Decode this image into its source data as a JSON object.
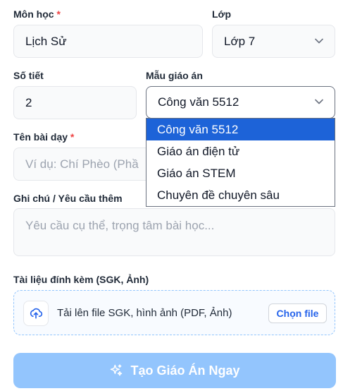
{
  "form": {
    "subject": {
      "label": "Môn học",
      "required_mark": "*",
      "value": "Lịch Sử"
    },
    "grade": {
      "label": "Lớp",
      "value": "Lớp 7"
    },
    "periods": {
      "label": "Số tiết",
      "value": "2"
    },
    "template": {
      "label": "Mẫu giáo án",
      "value": "Công văn 5512",
      "options": [
        "Công văn 5512",
        "Giáo án điện tử",
        "Giáo án STEM",
        "Chuyên đề chuyên sâu"
      ],
      "selected_index": 0
    },
    "lesson_name": {
      "label": "Tên bài dạy",
      "required_mark": "*",
      "placeholder": "Ví dụ: Chí Phèo (Phầ"
    },
    "notes": {
      "label": "Ghi chú / Yêu cầu thêm",
      "placeholder": "Yêu cầu cụ thể, trọng tâm bài học..."
    },
    "attachments": {
      "label": "Tài liệu đính kèm (SGK, Ảnh)",
      "upload_text": "Tải lên file SGK, hình ảnh (PDF, Ảnh)",
      "choose_label": "Chọn file",
      "icon": "cloud-upload-icon"
    },
    "submit": {
      "label": "Tạo Giáo Án Ngay",
      "icon": "sparkles-icon"
    }
  },
  "colors": {
    "accent": "#2563eb",
    "required": "#ef4444",
    "selected_option": "#1d63d8",
    "submit_disabled": "#93c5fd"
  }
}
